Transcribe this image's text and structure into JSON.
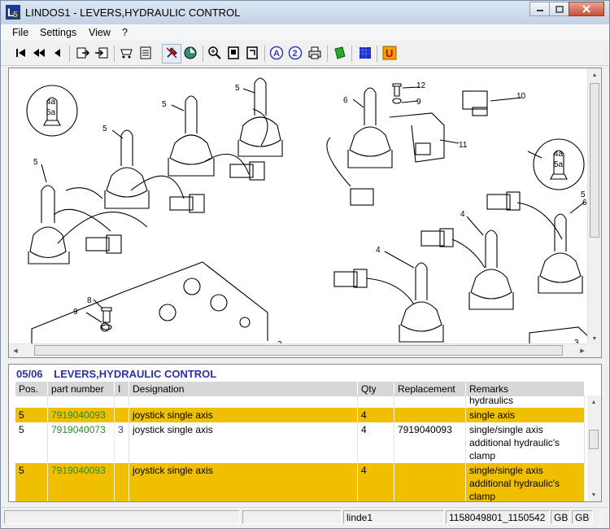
{
  "window": {
    "title": "LINDOS1 - LEVERS,HYDRAULIC CONTROL",
    "app_icon_letter": "L"
  },
  "menu": {
    "items": [
      "File",
      "Settings",
      "View",
      "?"
    ]
  },
  "toolbar": {
    "buttons": [
      "first-icon",
      "prev-fast-icon",
      "prev-icon",
      "export-icon",
      "import-icon",
      "cart-icon",
      "checklist-icon",
      "pin-icon",
      "globe-icon",
      "zoom-icon",
      "page-icon",
      "page2-icon",
      "a-icon",
      "2-icon",
      "print-icon",
      "green-book-icon",
      "blue-grid-icon",
      "u-icon"
    ]
  },
  "drawing": {
    "callouts": [
      "4a",
      "5a",
      "4a",
      "5a",
      "5",
      "5",
      "5",
      "5",
      "6",
      "12",
      "9",
      "10",
      "11",
      "5",
      "6",
      "4",
      "4",
      "8",
      "9",
      "2",
      "3"
    ]
  },
  "parts": {
    "group_code": "05/06",
    "group_title": "LEVERS,HYDRAULIC CONTROL",
    "columns": [
      "Pos.",
      "part number",
      "I",
      "Designation",
      "Qty",
      "Replacement",
      "Remarks"
    ],
    "partial_row_remarks": "hydraulics",
    "rows": [
      {
        "pos": "5",
        "part": "7919040093",
        "i": "",
        "designation": "joystick single axis",
        "qty": "4",
        "replacement": "",
        "remarks": [
          "single axis"
        ],
        "highlight": true
      },
      {
        "pos": "5",
        "part": "7919040073",
        "i": "3",
        "designation": "joystick single axis",
        "qty": "4",
        "replacement": "7919040093",
        "remarks": [
          "single/single axis",
          "additional hydraulic's",
          "clamp"
        ],
        "highlight": false
      },
      {
        "pos": "5",
        "part": "7919040093",
        "i": "",
        "designation": "joystick single axis",
        "qty": "4",
        "replacement": "",
        "remarks": [
          "single/single axis",
          "additional hydraulic's",
          "clamp"
        ],
        "highlight": true
      }
    ]
  },
  "status": {
    "user": "linde1",
    "ids": "1158049801_1150542",
    "lang1": "GB",
    "lang2": "GB"
  },
  "colors": {
    "highlight": "#f0c000",
    "part_number": "#2a8a2a",
    "title": "#2b30a8"
  }
}
